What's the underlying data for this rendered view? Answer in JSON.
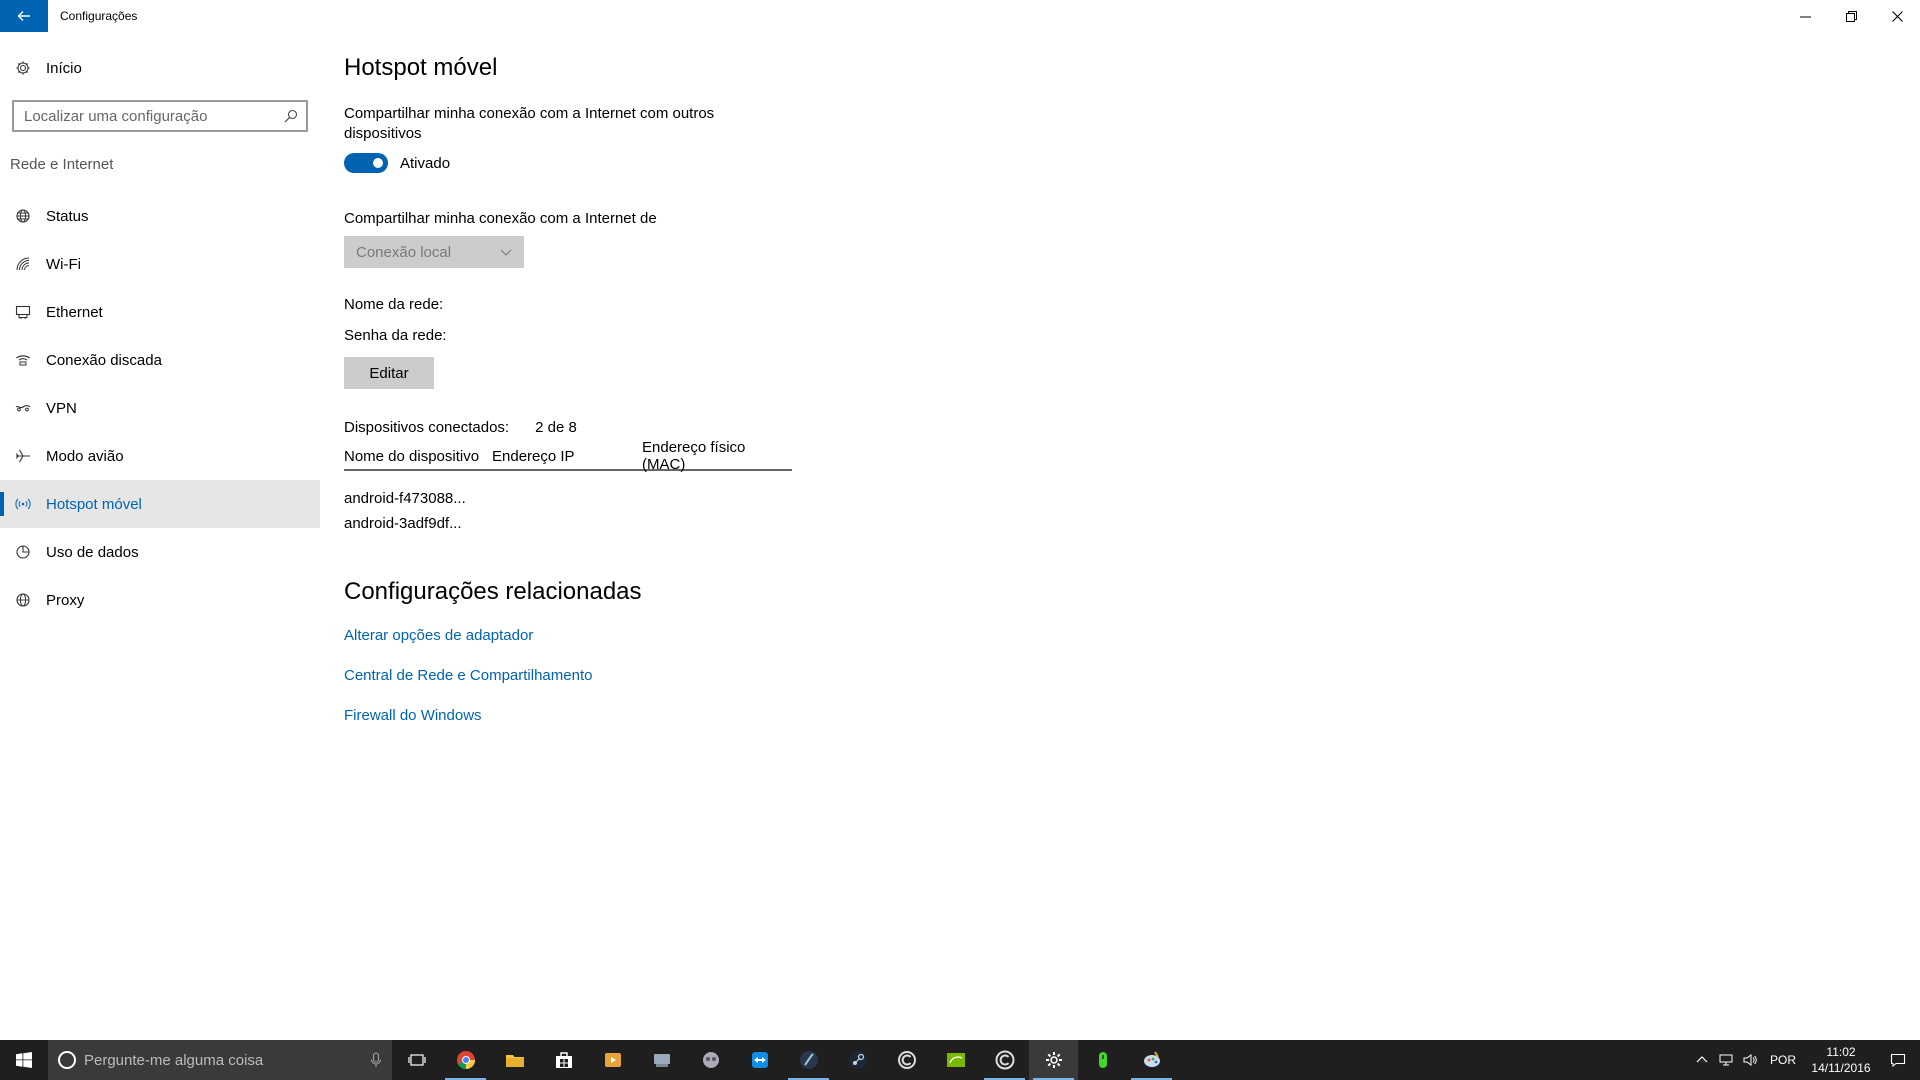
{
  "window": {
    "title": "Configurações",
    "accent": "#0063b1"
  },
  "sidebar": {
    "home_label": "Início",
    "search_placeholder": "Localizar uma configuração",
    "section_title": "Rede e Internet",
    "items": [
      {
        "label": "Status",
        "icon": "globe-status-icon"
      },
      {
        "label": "Wi-Fi",
        "icon": "wifi-icon"
      },
      {
        "label": "Ethernet",
        "icon": "ethernet-icon"
      },
      {
        "label": "Conexão discada",
        "icon": "dialup-icon"
      },
      {
        "label": "VPN",
        "icon": "vpn-icon"
      },
      {
        "label": "Modo avião",
        "icon": "airplane-icon"
      },
      {
        "label": "Hotspot móvel",
        "icon": "hotspot-icon",
        "active": true
      },
      {
        "label": "Uso de dados",
        "icon": "data-usage-icon"
      },
      {
        "label": "Proxy",
        "icon": "globe-icon"
      }
    ]
  },
  "main": {
    "title": "Hotspot móvel",
    "share_description": "Compartilhar minha conexão com a Internet com outros dispositivos",
    "toggle_state_label": "Ativado",
    "toggle_on": true,
    "share_from_label": "Compartilhar minha conexão com a Internet de",
    "share_from_value": "Conexão local",
    "network_name_label": "Nome da rede:",
    "network_password_label": "Senha da rede:",
    "edit_button": "Editar",
    "connected_label": "Dispositivos conectados:",
    "connected_value": "2 de 8",
    "table": {
      "headers": [
        "Nome do dispositivo",
        "Endereço IP",
        "Endereço físico (MAC)"
      ],
      "rows": [
        {
          "name": "android-f473088..."
        },
        {
          "name": "android-3adf9df..."
        }
      ]
    },
    "related_title": "Configurações relacionadas",
    "links": [
      "Alterar opções de adaptador",
      "Central de Rede e Compartilhamento",
      "Firewall do Windows"
    ]
  },
  "taskbar": {
    "search_placeholder": "Pergunte-me alguma coisa",
    "apps": [
      "task-view-icon",
      "chrome-icon",
      "file-explorer-icon",
      "store-icon",
      "media-player-icon",
      "network-app-icon",
      "gamepad-icon",
      "teamviewer-icon",
      "dark-app-icon",
      "steam-icon",
      "ccleaner-icon",
      "nvidia-icon",
      "cyberlink-icon",
      "settings-icon",
      "razer-icon",
      "paint-icon"
    ],
    "language": "POR",
    "time": "11:02",
    "date": "14/11/2016"
  }
}
